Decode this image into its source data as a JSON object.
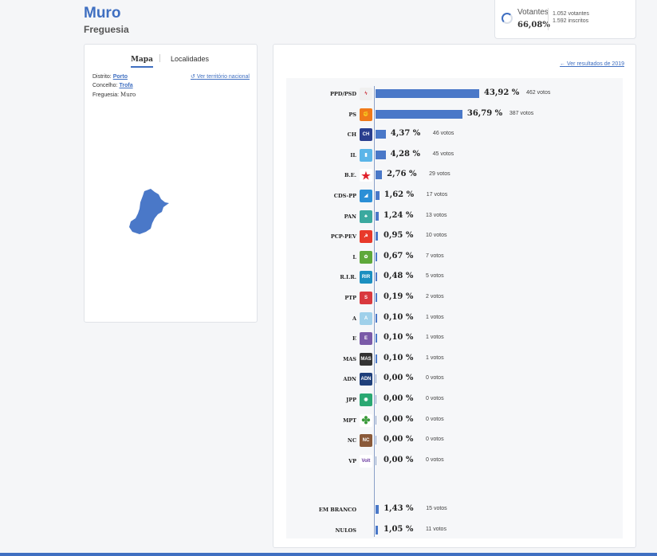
{
  "header": {
    "title": "Muro",
    "subtitle": "Freguesia"
  },
  "voters": {
    "label": "Votantes",
    "percentage": "66,08%",
    "count_text": "1.052 votantes",
    "registered_text": "1.592 inscritos"
  },
  "map_panel": {
    "tabs": [
      "Mapa",
      "Localidades"
    ],
    "district_label": "Distrito:",
    "district_value": "Porto",
    "council_label": "Concelho:",
    "council_value": "Trofa",
    "parish_label": "Freguesia:",
    "parish_value": "Muro",
    "view_national_link": "Ver território nacional"
  },
  "results": {
    "prev_results_link": "Ver resultados de 2019",
    "accent_color": "#4a78c8",
    "rows": [
      {
        "party": "PPD/PSD",
        "pct": 43.92,
        "pct_text": "43,92 %",
        "votes": "462 votos",
        "logo": "ppd-psd-icon",
        "logo_color": "#f0f0f0",
        "logo_text": "ϟ"
      },
      {
        "party": "PS",
        "pct": 36.79,
        "pct_text": "36,79 %",
        "votes": "387 votos",
        "logo": "ps-icon",
        "logo_color": "#f07a1a",
        "logo_text": "✊"
      },
      {
        "party": "CH",
        "pct": 4.37,
        "pct_text": "4,37 %",
        "votes": "46 votos",
        "logo": "ch-icon",
        "logo_color": "#2a3f8f",
        "logo_text": "CH"
      },
      {
        "party": "IL",
        "pct": 4.28,
        "pct_text": "4,28 %",
        "votes": "45 votos",
        "logo": "il-icon",
        "logo_color": "#5bb5e8",
        "logo_text": "▮"
      },
      {
        "party": "B.E.",
        "pct": 2.76,
        "pct_text": "2,76 %",
        "votes": "29 votos",
        "logo": "be-icon",
        "logo_color": "#ffffff",
        "logo_text": "★"
      },
      {
        "party": "CDS-PP",
        "pct": 1.62,
        "pct_text": "1,62 %",
        "votes": "17 votos",
        "logo": "cds-pp-icon",
        "logo_color": "#2b8fd6",
        "logo_text": "◢"
      },
      {
        "party": "PAN",
        "pct": 1.24,
        "pct_text": "1,24 %",
        "votes": "13 votos",
        "logo": "pan-icon",
        "logo_color": "#3aa99f",
        "logo_text": "♣"
      },
      {
        "party": "PCP-PEV",
        "pct": 0.95,
        "pct_text": "0,95 %",
        "votes": "10 votos",
        "logo": "pcp-pev-icon",
        "logo_color": "#e8392a",
        "logo_text": "☭"
      },
      {
        "party": "L",
        "pct": 0.67,
        "pct_text": "0,67 %",
        "votes": "7 votos",
        "logo": "livre-icon",
        "logo_color": "#5ea83a",
        "logo_text": "✿"
      },
      {
        "party": "R.I.R.",
        "pct": 0.48,
        "pct_text": "0,48 %",
        "votes": "5 votos",
        "logo": "rir-icon",
        "logo_color": "#1b8fc0",
        "logo_text": "RIR"
      },
      {
        "party": "PTP",
        "pct": 0.19,
        "pct_text": "0,19 %",
        "votes": "2 votos",
        "logo": "ptp-icon",
        "logo_color": "#d9393e",
        "logo_text": "S"
      },
      {
        "party": "A",
        "pct": 0.1,
        "pct_text": "0,10 %",
        "votes": "1 votos",
        "logo": "alianca-icon",
        "logo_color": "#9fd0ea",
        "logo_text": "A"
      },
      {
        "party": "E",
        "pct": 0.1,
        "pct_text": "0,10 %",
        "votes": "1 votos",
        "logo": "ergue-te-icon",
        "logo_color": "#7a5aa8",
        "logo_text": "E"
      },
      {
        "party": "MAS",
        "pct": 0.1,
        "pct_text": "0,10 %",
        "votes": "1 votos",
        "logo": "mas-icon",
        "logo_color": "#333333",
        "logo_text": "MAS"
      },
      {
        "party": "ADN",
        "pct": 0.0,
        "pct_text": "0,00 %",
        "votes": "0 votos",
        "logo": "adn-icon",
        "logo_color": "#1f3f7a",
        "logo_text": "ADN"
      },
      {
        "party": "JPP",
        "pct": 0.0,
        "pct_text": "0,00 %",
        "votes": "0 votos",
        "logo": "jpp-icon",
        "logo_color": "#2aa872",
        "logo_text": "◉"
      },
      {
        "party": "MPT",
        "pct": 0.0,
        "pct_text": "0,00 %",
        "votes": "0 votos",
        "logo": "mpt-icon",
        "logo_color": "#ffffff",
        "logo_text": "✤"
      },
      {
        "party": "NC",
        "pct": 0.0,
        "pct_text": "0,00 %",
        "votes": "0 votos",
        "logo": "nc-icon",
        "logo_color": "#8a5a3a",
        "logo_text": "NC"
      },
      {
        "party": "VP",
        "pct": 0.0,
        "pct_text": "0,00 %",
        "votes": "0 votos",
        "logo": "volt-icon",
        "logo_color": "#ffffff",
        "logo_text": "Volt"
      }
    ],
    "extra_rows": [
      {
        "party": "EM BRANCO",
        "pct": 1.43,
        "pct_text": "1,43 %",
        "votes": "15 votos"
      },
      {
        "party": "NULOS",
        "pct": 1.05,
        "pct_text": "1,05 %",
        "votes": "11 votos"
      }
    ]
  }
}
